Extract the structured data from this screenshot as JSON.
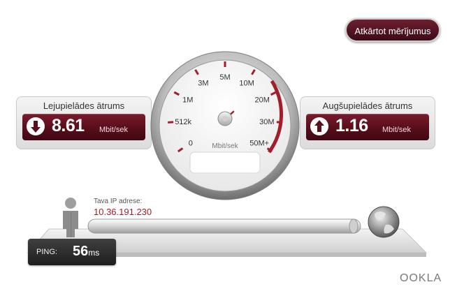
{
  "retest_button": {
    "label": "Atkārtot mērījumus"
  },
  "download": {
    "title": "Lejupielādes ātrums",
    "value": "8.61",
    "unit": "Mbit/sek"
  },
  "upload": {
    "title": "Augšupielādes ātrums",
    "value": "1.16",
    "unit": "Mbit/sek"
  },
  "gauge": {
    "labels": [
      "0",
      "512k",
      "1M",
      "3M",
      "5M",
      "10M",
      "20M",
      "30M",
      "50M+"
    ],
    "unit": "Mbit/sek",
    "accent": "#a31d2a"
  },
  "ip": {
    "label": "Tava IP adrese:",
    "value": "10.36.191.230"
  },
  "ping": {
    "label": "PING:",
    "value": "56",
    "unit": "ms"
  },
  "brand": {
    "name": "OOKLA"
  },
  "icons": {
    "download": "down-arrow-icon",
    "upload": "up-arrow-icon",
    "user": "user-figure-icon",
    "globe": "globe-icon"
  }
}
